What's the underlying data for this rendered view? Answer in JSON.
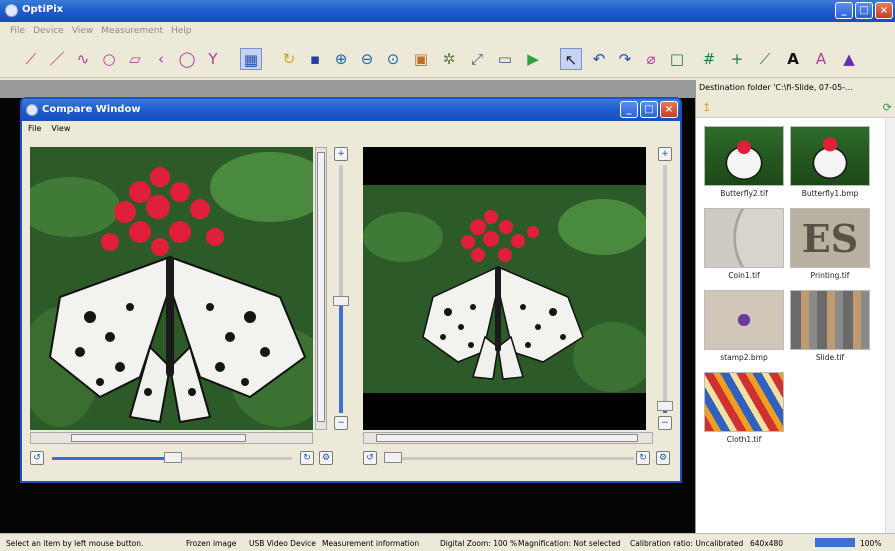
{
  "app": {
    "title": "OptiPix"
  },
  "menu": [
    "File",
    "Device",
    "View",
    "Measurement",
    "Help"
  ],
  "toolbar_icons": [
    "polyline-icon",
    "line-icon",
    "curve-icon",
    "ellipse-icon",
    "rect-tool-icon",
    "angle-icon",
    "circle-icon",
    "vertex-icon",
    "grid-view-icon",
    "open-icon",
    "save-icon",
    "zoom-in-icon",
    "zoom-out-icon",
    "zoom-fit-icon",
    "picture-icon",
    "effects-icon",
    "crop-icon",
    "capture-icon",
    "play-icon",
    "pointer-icon",
    "undo-icon",
    "redo-icon",
    "eraser-icon",
    "rectangle-icon",
    "crosshair-grid-icon",
    "plus-icon",
    "ruler-icon",
    "text-icon",
    "text-style-icon",
    "color-icon"
  ],
  "side": {
    "header": "Destination folder 'C:\\fi-Slide, 07-05-...",
    "thumbnails": [
      {
        "caption": "Butterfly2.tif"
      },
      {
        "caption": "Butterfly1.bmp"
      },
      {
        "caption": "Coin1.tif"
      },
      {
        "caption": "Printing.tif"
      },
      {
        "caption": "stamp2.bmp"
      },
      {
        "caption": "Slide.tif"
      },
      {
        "caption": "Cloth1.tif"
      }
    ]
  },
  "compare": {
    "title": "Compare Window",
    "menu": [
      "File",
      "View"
    ],
    "left_zoom_level": 0.45,
    "right_zoom_level": 0.03
  },
  "status": {
    "hint": "Select an item by left mouse button.",
    "frozen": "Frozen image",
    "device": "USB Video Device",
    "measurement": "Measurement information",
    "digital_zoom": "Digital Zoom: 100 %",
    "magnification": "Magnification: Not selected",
    "calibration": "Calibration ratio: Uncalibrated",
    "resolution": "640x480",
    "zoom_pct": "100%",
    "zoom_fill": 1.0
  },
  "colors": {
    "accent": "#1d5ad0",
    "slider": "#3b6fd0"
  }
}
